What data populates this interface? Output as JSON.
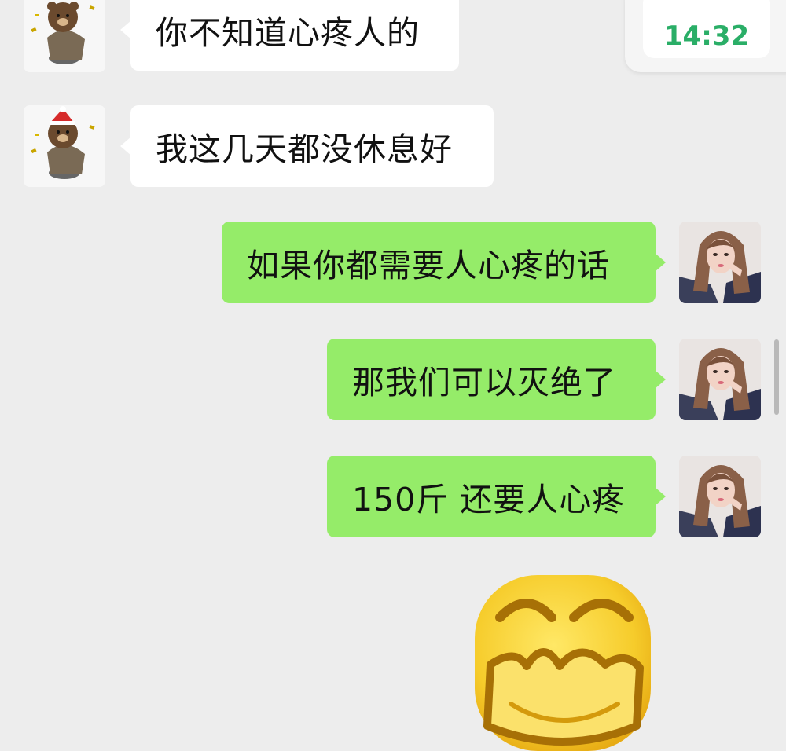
{
  "status": {
    "time": "14:32"
  },
  "messages": [
    {
      "id": "m1",
      "side": "in",
      "text": "你不知道心疼人的"
    },
    {
      "id": "m2",
      "side": "in",
      "text": "我这几天都没休息好"
    },
    {
      "id": "m3",
      "side": "out",
      "text": "如果你都需要人心疼的话"
    },
    {
      "id": "m4",
      "side": "out",
      "text": "那我们可以灭绝了"
    },
    {
      "id": "m5",
      "side": "out",
      "text": "150斤 还要人心疼"
    },
    {
      "id": "m6",
      "side": "out",
      "sticker": "laughing-yellow-face-emoji"
    }
  ],
  "colors": {
    "background": "#ededed",
    "incoming_bubble": "#ffffff",
    "outgoing_bubble": "#95ec69",
    "time_text": "#2aae67"
  },
  "icons": {
    "contact_avatar": "bear-avatar-icon",
    "self_avatar": "woman-avatar-icon"
  }
}
